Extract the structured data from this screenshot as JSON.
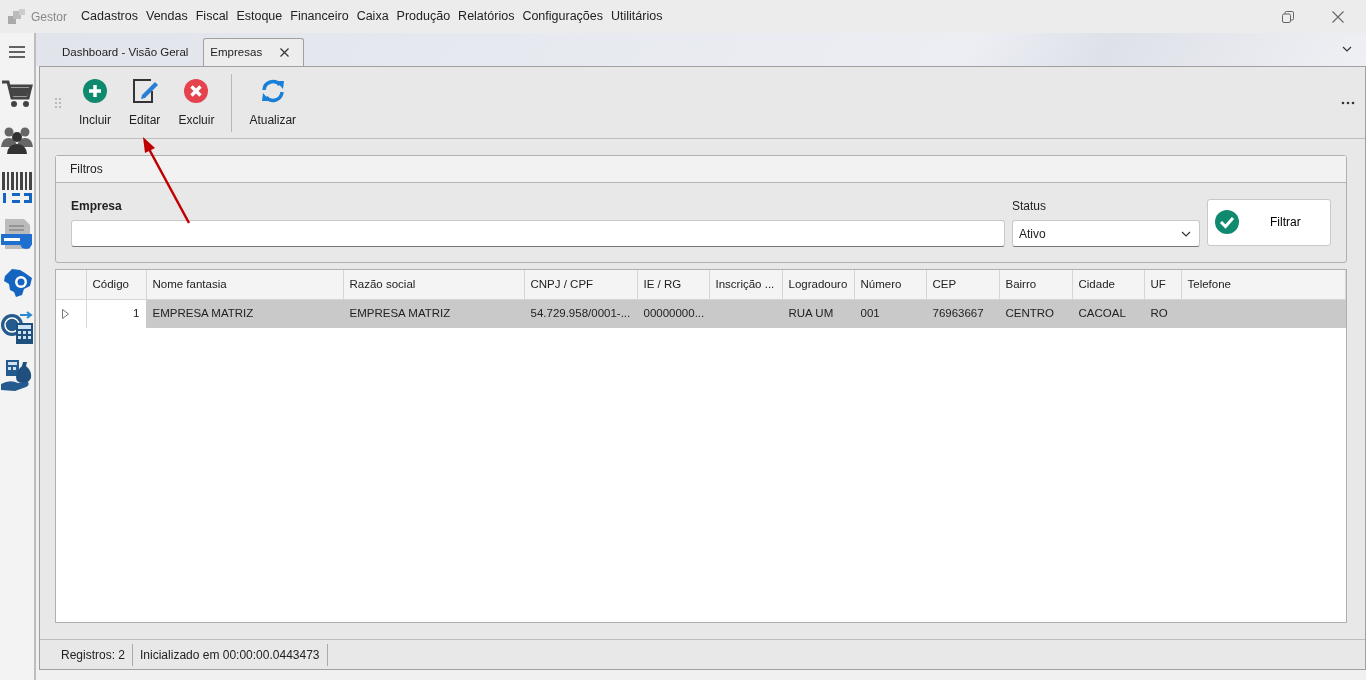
{
  "app": {
    "title": "Gestor"
  },
  "menu": [
    "Cadastros",
    "Vendas",
    "Fiscal",
    "Estoque",
    "Financeiro",
    "Caixa",
    "Produção",
    "Relatórios",
    "Configurações",
    "Utilitários"
  ],
  "sidebar": {
    "items": [
      {
        "kind": "cart"
      },
      {
        "kind": "people"
      },
      {
        "kind": "barcode"
      },
      {
        "kind": "nfse"
      },
      {
        "kind": "nfe"
      },
      {
        "kind": "money-calc"
      },
      {
        "kind": "money-hand"
      }
    ]
  },
  "tabs": [
    {
      "label": "Dashboard - Visão Geral",
      "selected": false,
      "closable": false
    },
    {
      "label": "Empresas",
      "selected": true,
      "closable": true
    }
  ],
  "toolbar": [
    {
      "label": "Incluir",
      "kind": "add"
    },
    {
      "label": "Editar",
      "kind": "edit"
    },
    {
      "label": "Excluir",
      "kind": "delete"
    },
    {
      "label": "Atualizar",
      "kind": "refresh"
    }
  ],
  "filters": {
    "title": "Filtros",
    "empresa_label": "Empresa",
    "status_label": "Status",
    "status_value": "Ativo",
    "button": "Filtrar"
  },
  "table": {
    "columns": [
      "Código",
      "Nome fantasia",
      "Razão social",
      "CNPJ / CPF",
      "IE / RG",
      "Inscrição ...",
      "Logradouro",
      "Número",
      "CEP",
      "Bairro",
      "Cidade",
      "UF",
      "Telefone"
    ],
    "rows": [
      {
        "selected": true,
        "cells": [
          "1",
          "EMPRESA MATRIZ",
          "EMPRESA MATRIZ",
          "54.729.958/0001-...",
          "00000000...",
          null,
          "RUA UM",
          "001",
          "76963667",
          "CENTRO",
          "CACOAL",
          "RO",
          null
        ]
      }
    ]
  },
  "status_bar": [
    "Registros: 2",
    "Inicializado em 00:00:00.0443473"
  ],
  "annotation": {
    "kind": "arrow"
  }
}
